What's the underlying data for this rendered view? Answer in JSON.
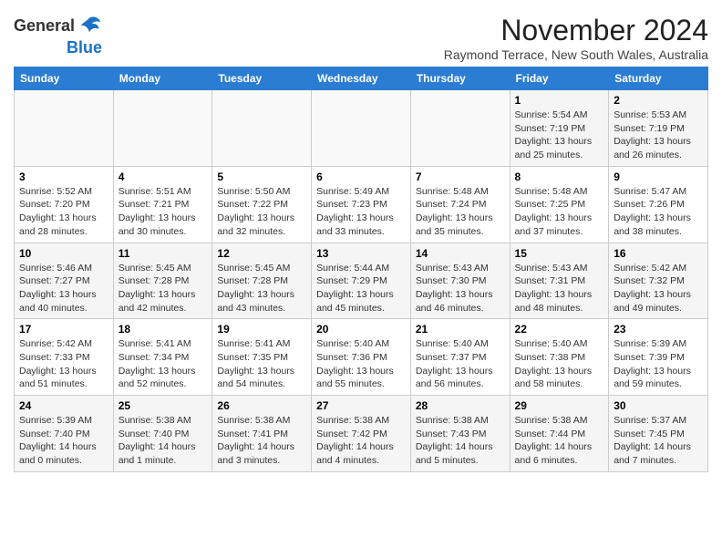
{
  "header": {
    "logo_line1": "General",
    "logo_line2": "Blue",
    "month_title": "November 2024",
    "location": "Raymond Terrace, New South Wales, Australia"
  },
  "weekdays": [
    "Sunday",
    "Monday",
    "Tuesday",
    "Wednesday",
    "Thursday",
    "Friday",
    "Saturday"
  ],
  "weeks": [
    [
      {
        "day": "",
        "detail": ""
      },
      {
        "day": "",
        "detail": ""
      },
      {
        "day": "",
        "detail": ""
      },
      {
        "day": "",
        "detail": ""
      },
      {
        "day": "",
        "detail": ""
      },
      {
        "day": "1",
        "detail": "Sunrise: 5:54 AM\nSunset: 7:19 PM\nDaylight: 13 hours\nand 25 minutes."
      },
      {
        "day": "2",
        "detail": "Sunrise: 5:53 AM\nSunset: 7:19 PM\nDaylight: 13 hours\nand 26 minutes."
      }
    ],
    [
      {
        "day": "3",
        "detail": "Sunrise: 5:52 AM\nSunset: 7:20 PM\nDaylight: 13 hours\nand 28 minutes."
      },
      {
        "day": "4",
        "detail": "Sunrise: 5:51 AM\nSunset: 7:21 PM\nDaylight: 13 hours\nand 30 minutes."
      },
      {
        "day": "5",
        "detail": "Sunrise: 5:50 AM\nSunset: 7:22 PM\nDaylight: 13 hours\nand 32 minutes."
      },
      {
        "day": "6",
        "detail": "Sunrise: 5:49 AM\nSunset: 7:23 PM\nDaylight: 13 hours\nand 33 minutes."
      },
      {
        "day": "7",
        "detail": "Sunrise: 5:48 AM\nSunset: 7:24 PM\nDaylight: 13 hours\nand 35 minutes."
      },
      {
        "day": "8",
        "detail": "Sunrise: 5:48 AM\nSunset: 7:25 PM\nDaylight: 13 hours\nand 37 minutes."
      },
      {
        "day": "9",
        "detail": "Sunrise: 5:47 AM\nSunset: 7:26 PM\nDaylight: 13 hours\nand 38 minutes."
      }
    ],
    [
      {
        "day": "10",
        "detail": "Sunrise: 5:46 AM\nSunset: 7:27 PM\nDaylight: 13 hours\nand 40 minutes."
      },
      {
        "day": "11",
        "detail": "Sunrise: 5:45 AM\nSunset: 7:28 PM\nDaylight: 13 hours\nand 42 minutes."
      },
      {
        "day": "12",
        "detail": "Sunrise: 5:45 AM\nSunset: 7:28 PM\nDaylight: 13 hours\nand 43 minutes."
      },
      {
        "day": "13",
        "detail": "Sunrise: 5:44 AM\nSunset: 7:29 PM\nDaylight: 13 hours\nand 45 minutes."
      },
      {
        "day": "14",
        "detail": "Sunrise: 5:43 AM\nSunset: 7:30 PM\nDaylight: 13 hours\nand 46 minutes."
      },
      {
        "day": "15",
        "detail": "Sunrise: 5:43 AM\nSunset: 7:31 PM\nDaylight: 13 hours\nand 48 minutes."
      },
      {
        "day": "16",
        "detail": "Sunrise: 5:42 AM\nSunset: 7:32 PM\nDaylight: 13 hours\nand 49 minutes."
      }
    ],
    [
      {
        "day": "17",
        "detail": "Sunrise: 5:42 AM\nSunset: 7:33 PM\nDaylight: 13 hours\nand 51 minutes."
      },
      {
        "day": "18",
        "detail": "Sunrise: 5:41 AM\nSunset: 7:34 PM\nDaylight: 13 hours\nand 52 minutes."
      },
      {
        "day": "19",
        "detail": "Sunrise: 5:41 AM\nSunset: 7:35 PM\nDaylight: 13 hours\nand 54 minutes."
      },
      {
        "day": "20",
        "detail": "Sunrise: 5:40 AM\nSunset: 7:36 PM\nDaylight: 13 hours\nand 55 minutes."
      },
      {
        "day": "21",
        "detail": "Sunrise: 5:40 AM\nSunset: 7:37 PM\nDaylight: 13 hours\nand 56 minutes."
      },
      {
        "day": "22",
        "detail": "Sunrise: 5:40 AM\nSunset: 7:38 PM\nDaylight: 13 hours\nand 58 minutes."
      },
      {
        "day": "23",
        "detail": "Sunrise: 5:39 AM\nSunset: 7:39 PM\nDaylight: 13 hours\nand 59 minutes."
      }
    ],
    [
      {
        "day": "24",
        "detail": "Sunrise: 5:39 AM\nSunset: 7:40 PM\nDaylight: 14 hours\nand 0 minutes."
      },
      {
        "day": "25",
        "detail": "Sunrise: 5:38 AM\nSunset: 7:40 PM\nDaylight: 14 hours\nand 1 minute."
      },
      {
        "day": "26",
        "detail": "Sunrise: 5:38 AM\nSunset: 7:41 PM\nDaylight: 14 hours\nand 3 minutes."
      },
      {
        "day": "27",
        "detail": "Sunrise: 5:38 AM\nSunset: 7:42 PM\nDaylight: 14 hours\nand 4 minutes."
      },
      {
        "day": "28",
        "detail": "Sunrise: 5:38 AM\nSunset: 7:43 PM\nDaylight: 14 hours\nand 5 minutes."
      },
      {
        "day": "29",
        "detail": "Sunrise: 5:38 AM\nSunset: 7:44 PM\nDaylight: 14 hours\nand 6 minutes."
      },
      {
        "day": "30",
        "detail": "Sunrise: 5:37 AM\nSunset: 7:45 PM\nDaylight: 14 hours\nand 7 minutes."
      }
    ]
  ]
}
